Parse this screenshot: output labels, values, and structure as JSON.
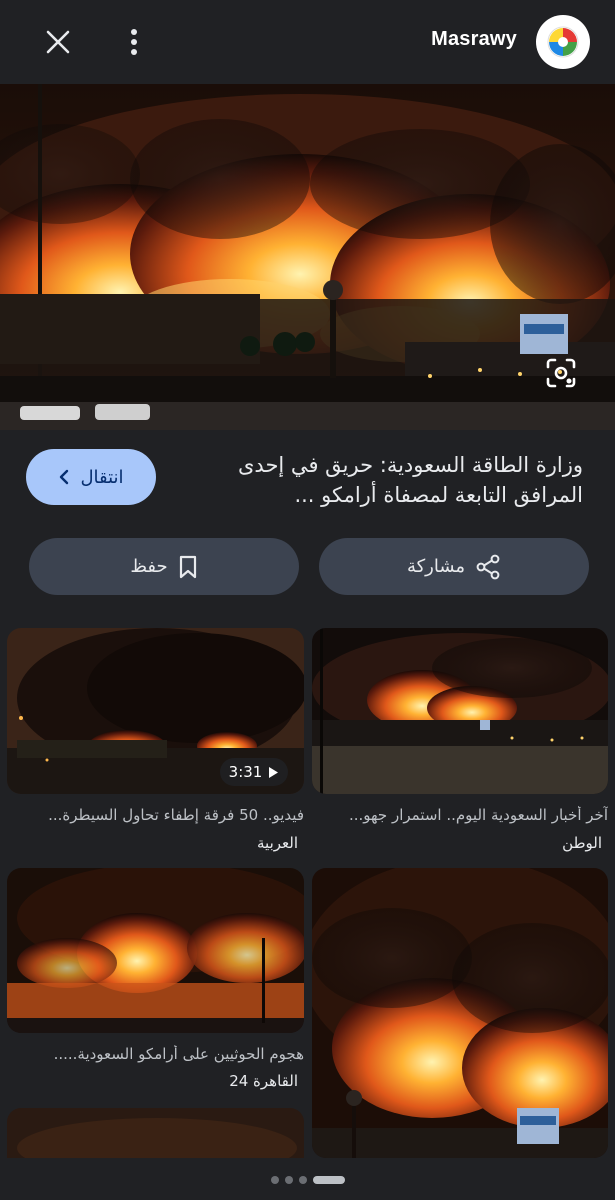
{
  "header": {
    "source_name": "Masrawy",
    "close_icon": "close-icon",
    "more_icon": "more-vert-icon"
  },
  "article": {
    "title": "وزارة الطاقة السعودية: حريق في إحدى المرافق التابعة لمصفاة أرامكو ...",
    "visit_label": "انتقال",
    "share_label": "مشاركة",
    "save_label": "حفظ"
  },
  "related": [
    {
      "caption": "آخر أخبار السعودية اليوم.. استمرار جهو...",
      "source": "الوطن"
    },
    {
      "caption": "فيديو.. 50 فرقة إطفاء تحاول السيطرة...",
      "source": "العربية",
      "duration": "3:31"
    },
    {
      "caption": "هجوم الحوثيين على أرامكو السعودية.....",
      "source": "القاهرة 24"
    },
    {
      "caption": "",
      "source": ""
    }
  ],
  "pager": {
    "pages": 4,
    "active": 3
  },
  "colors": {
    "background": "#202124",
    "visit_button": "#a8c7fa",
    "action_button": "#3c4350"
  }
}
